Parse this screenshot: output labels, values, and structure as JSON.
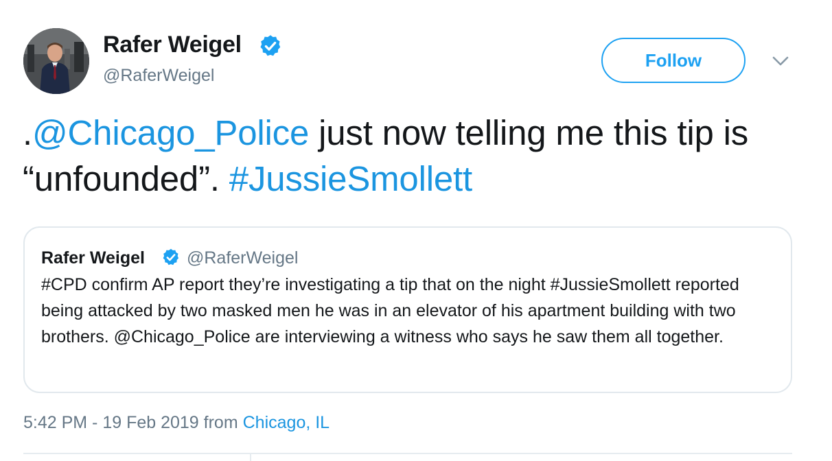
{
  "author": {
    "name": "Rafer Weigel",
    "handle": "@RaferWeigel",
    "avatar_icon": "profile-photo",
    "verified_icon": "verified-badge-icon"
  },
  "actions": {
    "follow_label": "Follow",
    "more_icon": "chevron-down-icon"
  },
  "tweet": {
    "text_prefix": ".",
    "mention": "@Chicago_Police",
    "text_middle": " just now telling me this tip is “unfounded”. ",
    "hashtag": "#JussieSmollett"
  },
  "quoted_tweet": {
    "name": "Rafer Weigel",
    "handle": "@RaferWeigel",
    "text": "#CPD confirm AP report they’re investigating a tip that on the night #JussieSmollett reported being attacked by two masked men he was in an elevator of his apartment building with two brothers. @Chicago_Police are interviewing a witness who says he saw them all together."
  },
  "meta": {
    "timestamp": "5:42 PM - 19 Feb 2019",
    "from_label": " from ",
    "location": "Chicago, IL"
  },
  "colors": {
    "accent": "#1da1f2",
    "link": "#1b95e0",
    "text": "#14171a",
    "secondary": "#657786",
    "border": "#e1e8ed"
  }
}
